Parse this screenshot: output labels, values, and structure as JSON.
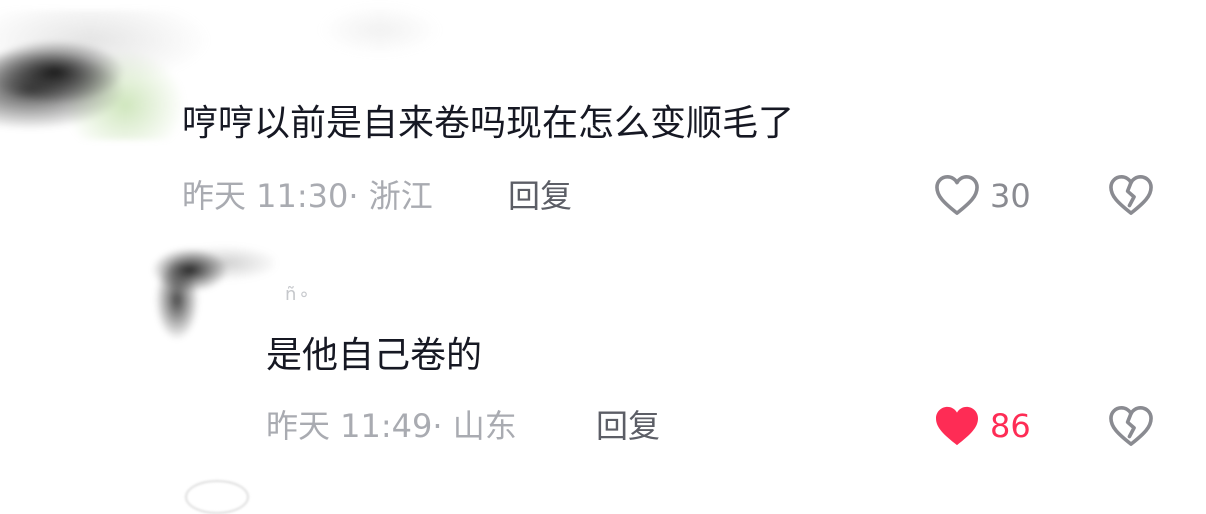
{
  "comments": [
    {
      "text": "哼哼以前是自来卷吗现在怎么变顺毛了",
      "time": "昨天 11:30",
      "location": "· 浙江",
      "reply_label": "回复",
      "likes": "30",
      "liked": false
    },
    {
      "username_fragment": "ñ∘",
      "text": "是他自己卷的",
      "time": "昨天 11:49",
      "location": "· 山东",
      "reply_label": "回复",
      "likes": "86",
      "liked": true
    }
  ],
  "colors": {
    "text": "#161823",
    "meta": "#a9abb1",
    "reply": "#5c5e66",
    "liked": "#fe2c55",
    "icon": "#8a8b91"
  }
}
